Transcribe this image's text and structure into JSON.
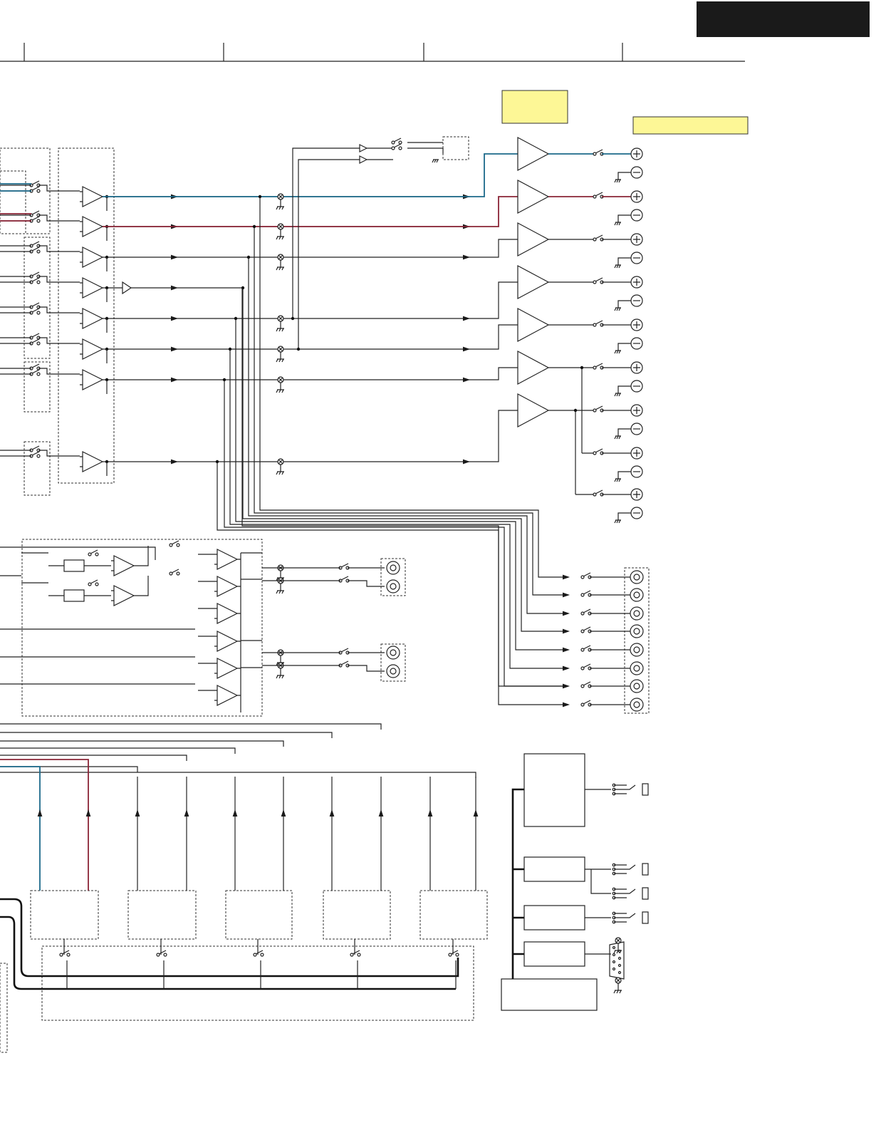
{
  "colors": {
    "background": "#ffffff",
    "header_block": "#1a1a1a",
    "highlight_box": "#fdf796",
    "front_channel_trace": "#1c6a8a",
    "front_right_trace": "#8a2436",
    "wire": "#222222"
  },
  "labels": {},
  "icons": {
    "speaker_plus": "plus-terminal-icon",
    "speaker_minus": "minus-terminal-icon",
    "rca_jack": "rca-jack-icon",
    "ground": "ground-icon",
    "mute_cross": "mute-cross-icon",
    "dsub": "dsub-connector-icon",
    "phone_jack": "phone-jack-icon"
  }
}
